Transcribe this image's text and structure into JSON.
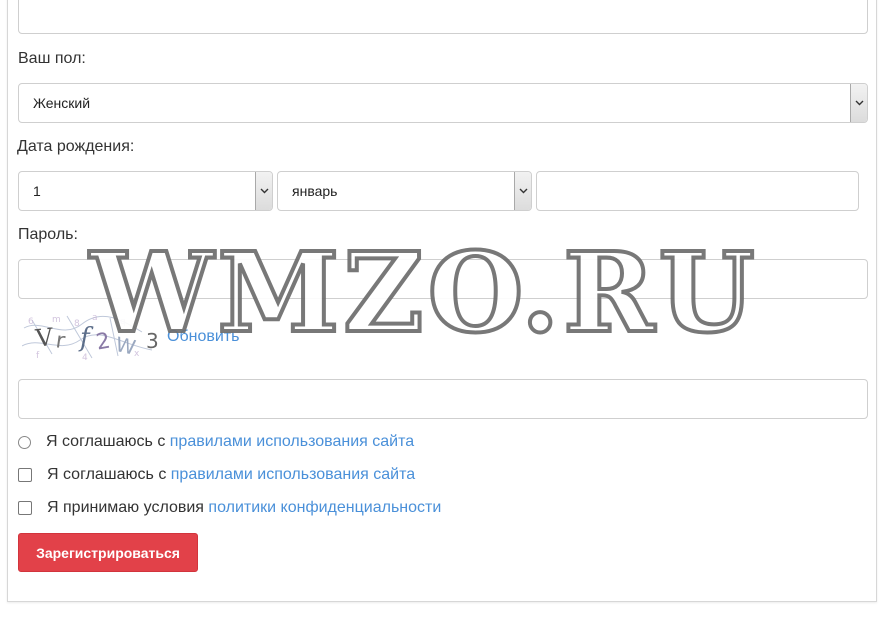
{
  "form": {
    "gender_label": "Ваш пол:",
    "gender_value": "Женский",
    "birthdate_label": "Дата рождения:",
    "birth_day_value": "1",
    "birth_month_value": "январь",
    "birth_year_value": "",
    "password_label": "Пароль:",
    "password_value": "",
    "captcha_text": "Vr f2W 3",
    "captcha_refresh": "Обновить",
    "captcha_input_value": "",
    "agree_rules_radio_text": "Я соглашаюсь с ",
    "agree_rules_radio_link": "правилами использования сайта",
    "agree_rules_check_text": "Я соглашаюсь с ",
    "agree_rules_check_link": "правилами использования сайта",
    "accept_privacy_text": "Я принимаю условия ",
    "accept_privacy_link": "политики конфиденциальности",
    "submit_label": "Зарегистрироваться"
  },
  "watermark": "WMZO.RU",
  "colors": {
    "link": "#4a90d9",
    "submit_bg": "#e24149"
  }
}
